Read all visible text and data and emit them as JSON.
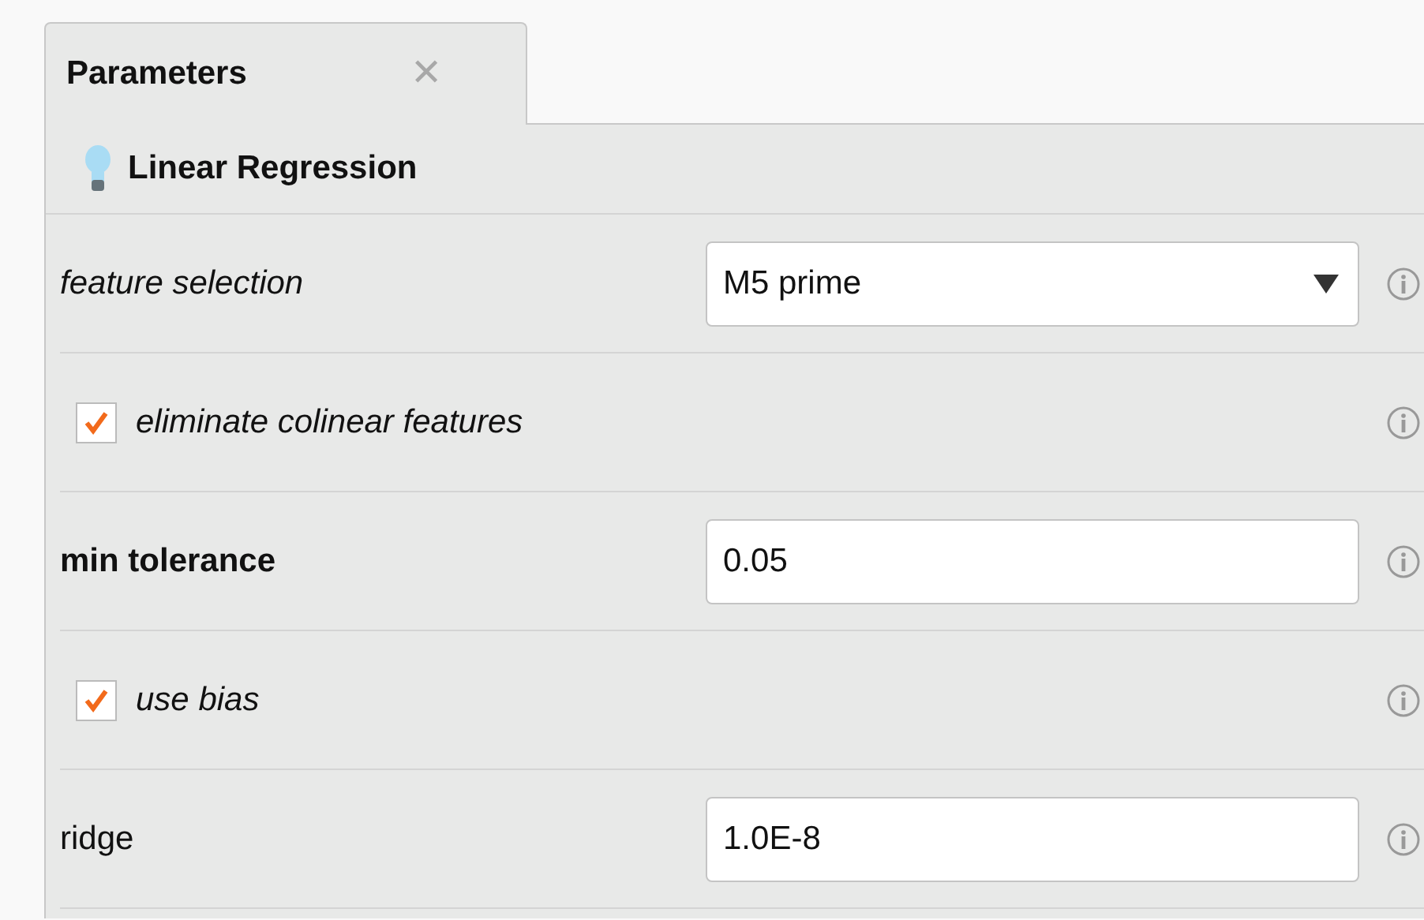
{
  "tab": {
    "label": "Parameters",
    "close": "✕"
  },
  "operator": {
    "title": "Linear Regression"
  },
  "parameters": [
    {
      "kind": "select",
      "label": "feature selection",
      "value": "M5 prime",
      "expert": true,
      "mandatory": false
    },
    {
      "kind": "checkbox",
      "label": "eliminate colinear features",
      "checked": true,
      "expert": true,
      "mandatory": false
    },
    {
      "kind": "text",
      "label": "min tolerance",
      "value": "0.05",
      "expert": false,
      "mandatory": true
    },
    {
      "kind": "checkbox",
      "label": "use bias",
      "checked": true,
      "expert": true,
      "mandatory": false
    },
    {
      "kind": "text",
      "label": "ridge",
      "value": "1.0E-8",
      "expert": false,
      "mandatory": false
    }
  ]
}
